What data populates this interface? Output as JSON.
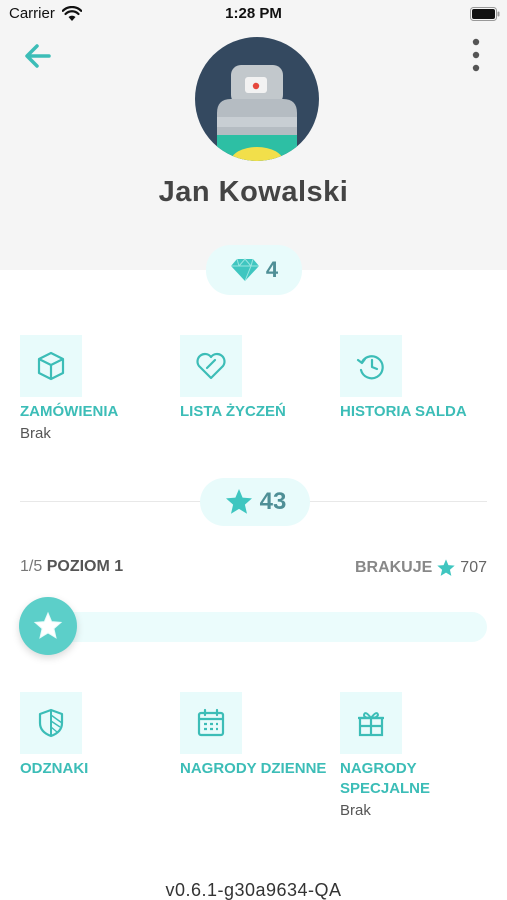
{
  "status_bar": {
    "carrier": "Carrier",
    "time": "1:28 PM"
  },
  "profile": {
    "name": "Jan Kowalski",
    "gems": "4",
    "stars": "43"
  },
  "menu_top": [
    {
      "label": "ZAMÓWIENIA",
      "sub": "Brak",
      "icon": "box-icon"
    },
    {
      "label": "LISTA ŻYCZEŃ",
      "sub": "",
      "icon": "heart-icon"
    },
    {
      "label": "HISTORIA SALDA",
      "sub": "",
      "icon": "history-icon"
    }
  ],
  "level": {
    "count": "1/5",
    "name": "POZIOM 1",
    "missing_label": "BRAKUJE",
    "missing_value": "707",
    "progress": 0.0
  },
  "menu_bottom": [
    {
      "label": "ODZNAKI",
      "sub": "",
      "icon": "shield-badge-icon"
    },
    {
      "label": "NAGRODY DZIENNE",
      "sub": "",
      "icon": "calendar-icon"
    },
    {
      "label": "NAGRODY SPECJALNE",
      "sub": "Brak",
      "icon": "gift-icon"
    }
  ],
  "version": "v0.6.1-g30a9634-QA",
  "colors": {
    "accent": "#3cbdb7",
    "pill_bg": "#e8fbfb",
    "header_bg": "#f5f5f5",
    "avatar_bg": "#344960"
  }
}
